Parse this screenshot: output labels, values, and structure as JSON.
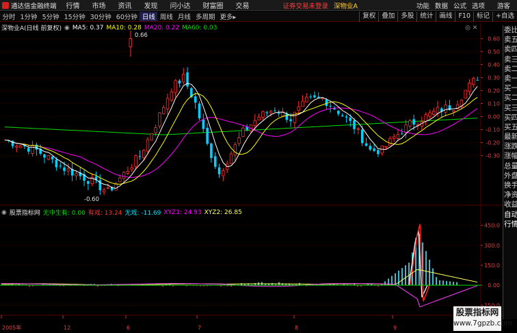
{
  "menubar": {
    "app_title": "通达信金融终端",
    "items": [
      "行情",
      "市场",
      "资讯",
      "发现",
      "问小达",
      "财富圈",
      "交易"
    ],
    "warning": "证券交易未登录",
    "stock_name": "深物业A",
    "right_items": [
      "功能",
      "数据",
      "公式",
      "选项"
    ],
    "guest": "游客"
  },
  "toolbar": {
    "periods": [
      "分时",
      "1分钟",
      "5分钟",
      "15分钟",
      "30分钟",
      "60分钟",
      "日线",
      "周线",
      "月线",
      "多周期",
      "更多"
    ],
    "active_period": "日线",
    "more_arrow": "▸",
    "tools": [
      "复权",
      "叠加",
      "多股",
      "统计",
      "画线",
      "F10",
      "标记",
      "+自选"
    ]
  },
  "main_legend": {
    "title": "深物业A(日线 前复权)",
    "ma": [
      {
        "label": "MA5: 0.37",
        "color": "#ffffff"
      },
      {
        "label": "MA10: 0.28",
        "color": "#ffff00"
      },
      {
        "label": "MA20: 0.22",
        "color": "#ff00ff"
      },
      {
        "label": "MA60: 0.03",
        "color": "#00e000"
      }
    ]
  },
  "sub_legend": {
    "title": "股票指标网",
    "items": [
      {
        "label": "无中生有: 0.00",
        "color": "#00e000"
      },
      {
        "label": "有戏: 13.24",
        "color": "#ff3030"
      },
      {
        "label": "无戏: -11.69",
        "color": "#00e5ff"
      },
      {
        "label": "XYZ1: 24.93",
        "color": "#ff00ff"
      },
      {
        "label": "XYZ2: 26.85",
        "color": "#ffff60"
      }
    ]
  },
  "main_axis": {
    "labels": [
      "0.60",
      "0.50",
      "0.40",
      "0.30",
      "0.20",
      "0.10",
      "0.00",
      "-0.10",
      "-0.20",
      "-0.30"
    ],
    "values": [
      0.6,
      0.5,
      0.4,
      0.3,
      0.2,
      0.1,
      0.0,
      -0.1,
      -0.2,
      -0.3
    ],
    "annot_high": "0.66",
    "annot_low": "-0.60"
  },
  "sub_axis": {
    "labels": [
      "450.0",
      "300.0",
      "150.0",
      "0.00",
      "-150.0"
    ],
    "values": [
      450,
      300,
      150,
      0,
      -150
    ]
  },
  "date_axis": {
    "labels": [
      "2005年",
      "12",
      "6",
      "7",
      "8",
      "9"
    ]
  },
  "sidebar": {
    "items": [
      "委比",
      "卖五",
      "卖四",
      "卖三",
      "卖二",
      "卖一",
      "买一",
      "买二",
      "买三",
      "买四",
      "买五",
      "最新",
      "涨跌",
      "涨幅",
      "总量",
      "外盘",
      "换手",
      "净资",
      "收益",
      "自动",
      "行情"
    ]
  },
  "watermark": {
    "line1": "股票指标网",
    "line2": "www.7gpzb.com"
  },
  "colors": {
    "up": "#ff3232",
    "down": "#00d0ff",
    "ma5": "#ffffff",
    "ma10": "#ffff00",
    "ma20": "#ff00ff",
    "ma60": "#00e000",
    "grid": "#5a0000"
  }
}
